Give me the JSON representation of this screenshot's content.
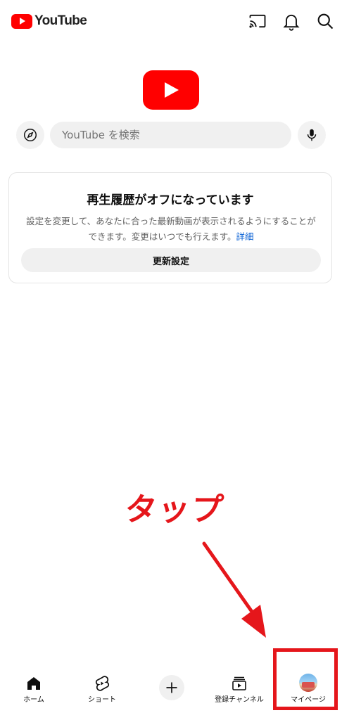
{
  "header": {
    "logo_text": "YouTube",
    "icons": [
      "cast-icon",
      "bell-icon",
      "search-icon"
    ]
  },
  "search": {
    "placeholder": "YouTube を検索"
  },
  "history_card": {
    "title": "再生履歴がオフになっています",
    "description": "設定を変更して、あなたに合った最新動画が表示されるようにすることができます。変更はいつでも行えます。",
    "link": "詳細",
    "button": "更新設定"
  },
  "annotation": {
    "label": "タップ",
    "color": "#e5161b"
  },
  "bottom_nav": {
    "home": "ホーム",
    "shorts": "ショート",
    "create": "+",
    "subscriptions": "登録チャンネル",
    "mypage": "マイページ"
  },
  "colors": {
    "brand": "#ff0000",
    "link": "#065fd4",
    "annotation": "#e5161b"
  }
}
